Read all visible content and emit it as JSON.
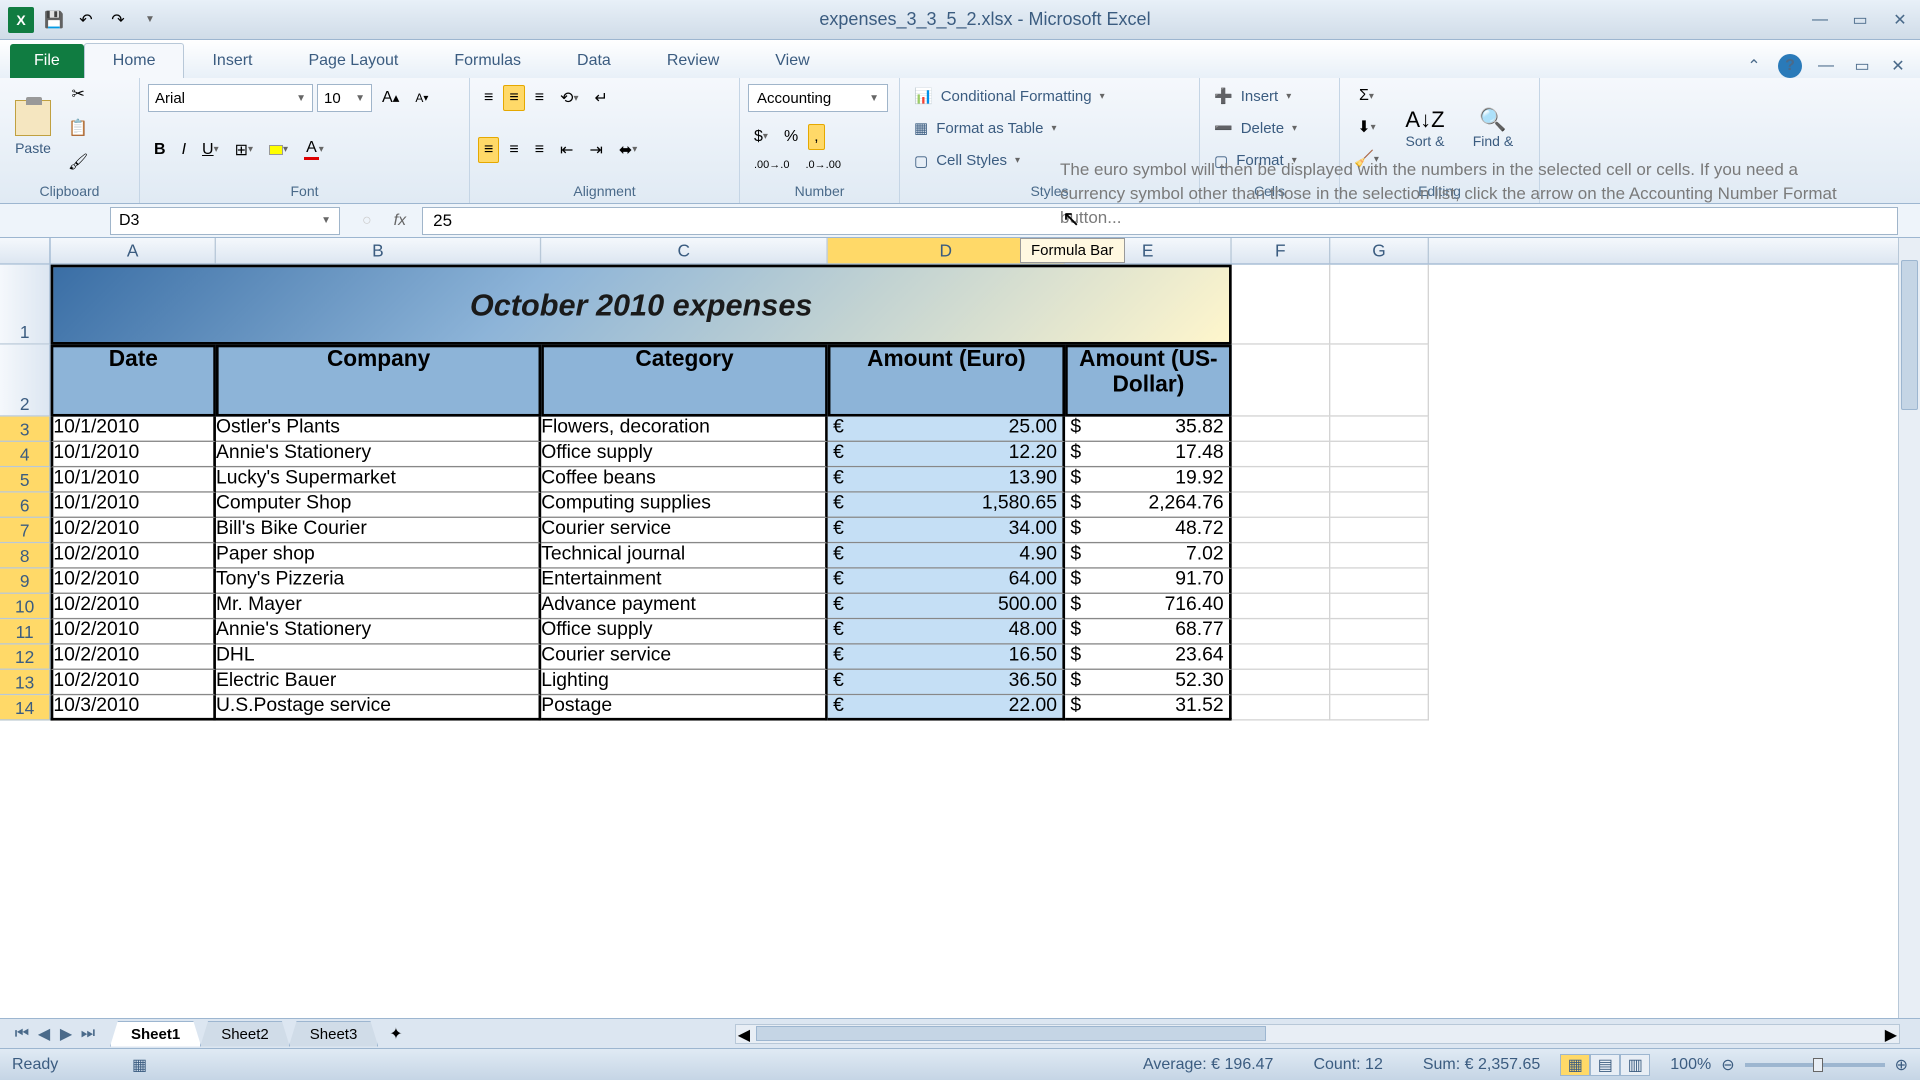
{
  "app": {
    "title": "expenses_3_3_5_2.xlsx - Microsoft Excel"
  },
  "tabs": {
    "file": "File",
    "home": "Home",
    "insert": "Insert",
    "pagelayout": "Page Layout",
    "formulas": "Formulas",
    "data": "Data",
    "review": "Review",
    "view": "View"
  },
  "ribbon": {
    "clipboard": {
      "paste": "Paste",
      "label": "Clipboard"
    },
    "font": {
      "name": "Arial",
      "size": "10",
      "label": "Font"
    },
    "alignment": {
      "label": "Alignment"
    },
    "number": {
      "format": "Accounting",
      "label": "Number"
    },
    "styles": {
      "cond": "Conditional Formatting",
      "table": "Format as Table",
      "cellstyles": "Cell Styles",
      "label": "Styles"
    },
    "cells": {
      "insert": "Insert",
      "delete": "Delete",
      "format": "Format",
      "label": "Cells"
    },
    "editing": {
      "sort": "Sort &",
      "find": "Find &",
      "label": "Editing"
    }
  },
  "tooltip_text": "The euro symbol will then be displayed with the numbers in the selected cell or cells. If you need a currency symbol other than those in the selection list, click the arrow on the Accounting Number Format button...",
  "namebox": "D3",
  "formula_value": "25",
  "formula_bar_label": "Formula Bar",
  "columns": [
    "A",
    "B",
    "C",
    "D",
    "E",
    "F",
    "G"
  ],
  "sheet": {
    "title": "October 2010 expenses",
    "headers": {
      "date": "Date",
      "company": "Company",
      "category": "Category",
      "euro": "Amount (Euro)",
      "usd": "Amount (US-Dollar)"
    },
    "rows": [
      {
        "n": 3,
        "date": "10/1/2010",
        "company": "Ostler's Plants",
        "category": "Flowers, decoration",
        "euro": "25.00",
        "usd": "35.82"
      },
      {
        "n": 4,
        "date": "10/1/2010",
        "company": "Annie's Stationery",
        "category": "Office supply",
        "euro": "12.20",
        "usd": "17.48"
      },
      {
        "n": 5,
        "date": "10/1/2010",
        "company": "Lucky's Supermarket",
        "category": "Coffee beans",
        "euro": "13.90",
        "usd": "19.92"
      },
      {
        "n": 6,
        "date": "10/1/2010",
        "company": "Computer Shop",
        "category": "Computing supplies",
        "euro": "1,580.65",
        "usd": "2,264.76"
      },
      {
        "n": 7,
        "date": "10/2/2010",
        "company": "Bill's Bike Courier",
        "category": "Courier service",
        "euro": "34.00",
        "usd": "48.72"
      },
      {
        "n": 8,
        "date": "10/2/2010",
        "company": "Paper shop",
        "category": "Technical journal",
        "euro": "4.90",
        "usd": "7.02"
      },
      {
        "n": 9,
        "date": "10/2/2010",
        "company": "Tony's Pizzeria",
        "category": "Entertainment",
        "euro": "64.00",
        "usd": "91.70"
      },
      {
        "n": 10,
        "date": "10/2/2010",
        "company": "Mr. Mayer",
        "category": "Advance payment",
        "euro": "500.00",
        "usd": "716.40"
      },
      {
        "n": 11,
        "date": "10/2/2010",
        "company": "Annie's Stationery",
        "category": "Office supply",
        "euro": "48.00",
        "usd": "68.77"
      },
      {
        "n": 12,
        "date": "10/2/2010",
        "company": "DHL",
        "category": "Courier service",
        "euro": "16.50",
        "usd": "23.64"
      },
      {
        "n": 13,
        "date": "10/2/2010",
        "company": "Electric Bauer",
        "category": "Lighting",
        "euro": "36.50",
        "usd": "52.30"
      },
      {
        "n": 14,
        "date": "10/3/2010",
        "company": "U.S.Postage service",
        "category": "Postage",
        "euro": "22.00",
        "usd": "31.52"
      }
    ]
  },
  "sheets": {
    "s1": "Sheet1",
    "s2": "Sheet2",
    "s3": "Sheet3"
  },
  "status": {
    "ready": "Ready",
    "avg_label": "Average:",
    "avg_val": "€ 196.47",
    "count_label": "Count:",
    "count_val": "12",
    "sum_label": "Sum:",
    "sum_val": "€ 2,357.65",
    "zoom": "100%"
  }
}
